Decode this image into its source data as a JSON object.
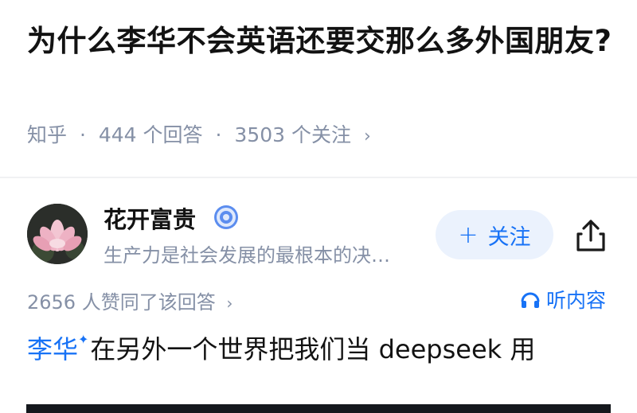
{
  "question": {
    "title": "为什么李华不会英语还要交那么多外国朋友?",
    "source": "知乎",
    "answer_count": "444 个回答",
    "follower_count": "3503 个关注",
    "separator": "·"
  },
  "author": {
    "name": "花开富贵",
    "bio": "生产力是社会发展的最根本的决…",
    "verified": true
  },
  "follow_button": {
    "label": "关注",
    "icon": "plus-icon"
  },
  "share_button": {
    "icon": "share-icon"
  },
  "answer": {
    "vote_summary": "2656 人赞同了该回答",
    "listen_label": "听内容",
    "mention": "李华",
    "body": "在另外一个世界把我们当 deepseek 用"
  },
  "colors": {
    "accent": "#1772f6",
    "meta_gray": "#8590a6",
    "follow_bg": "#ebf2fd"
  }
}
